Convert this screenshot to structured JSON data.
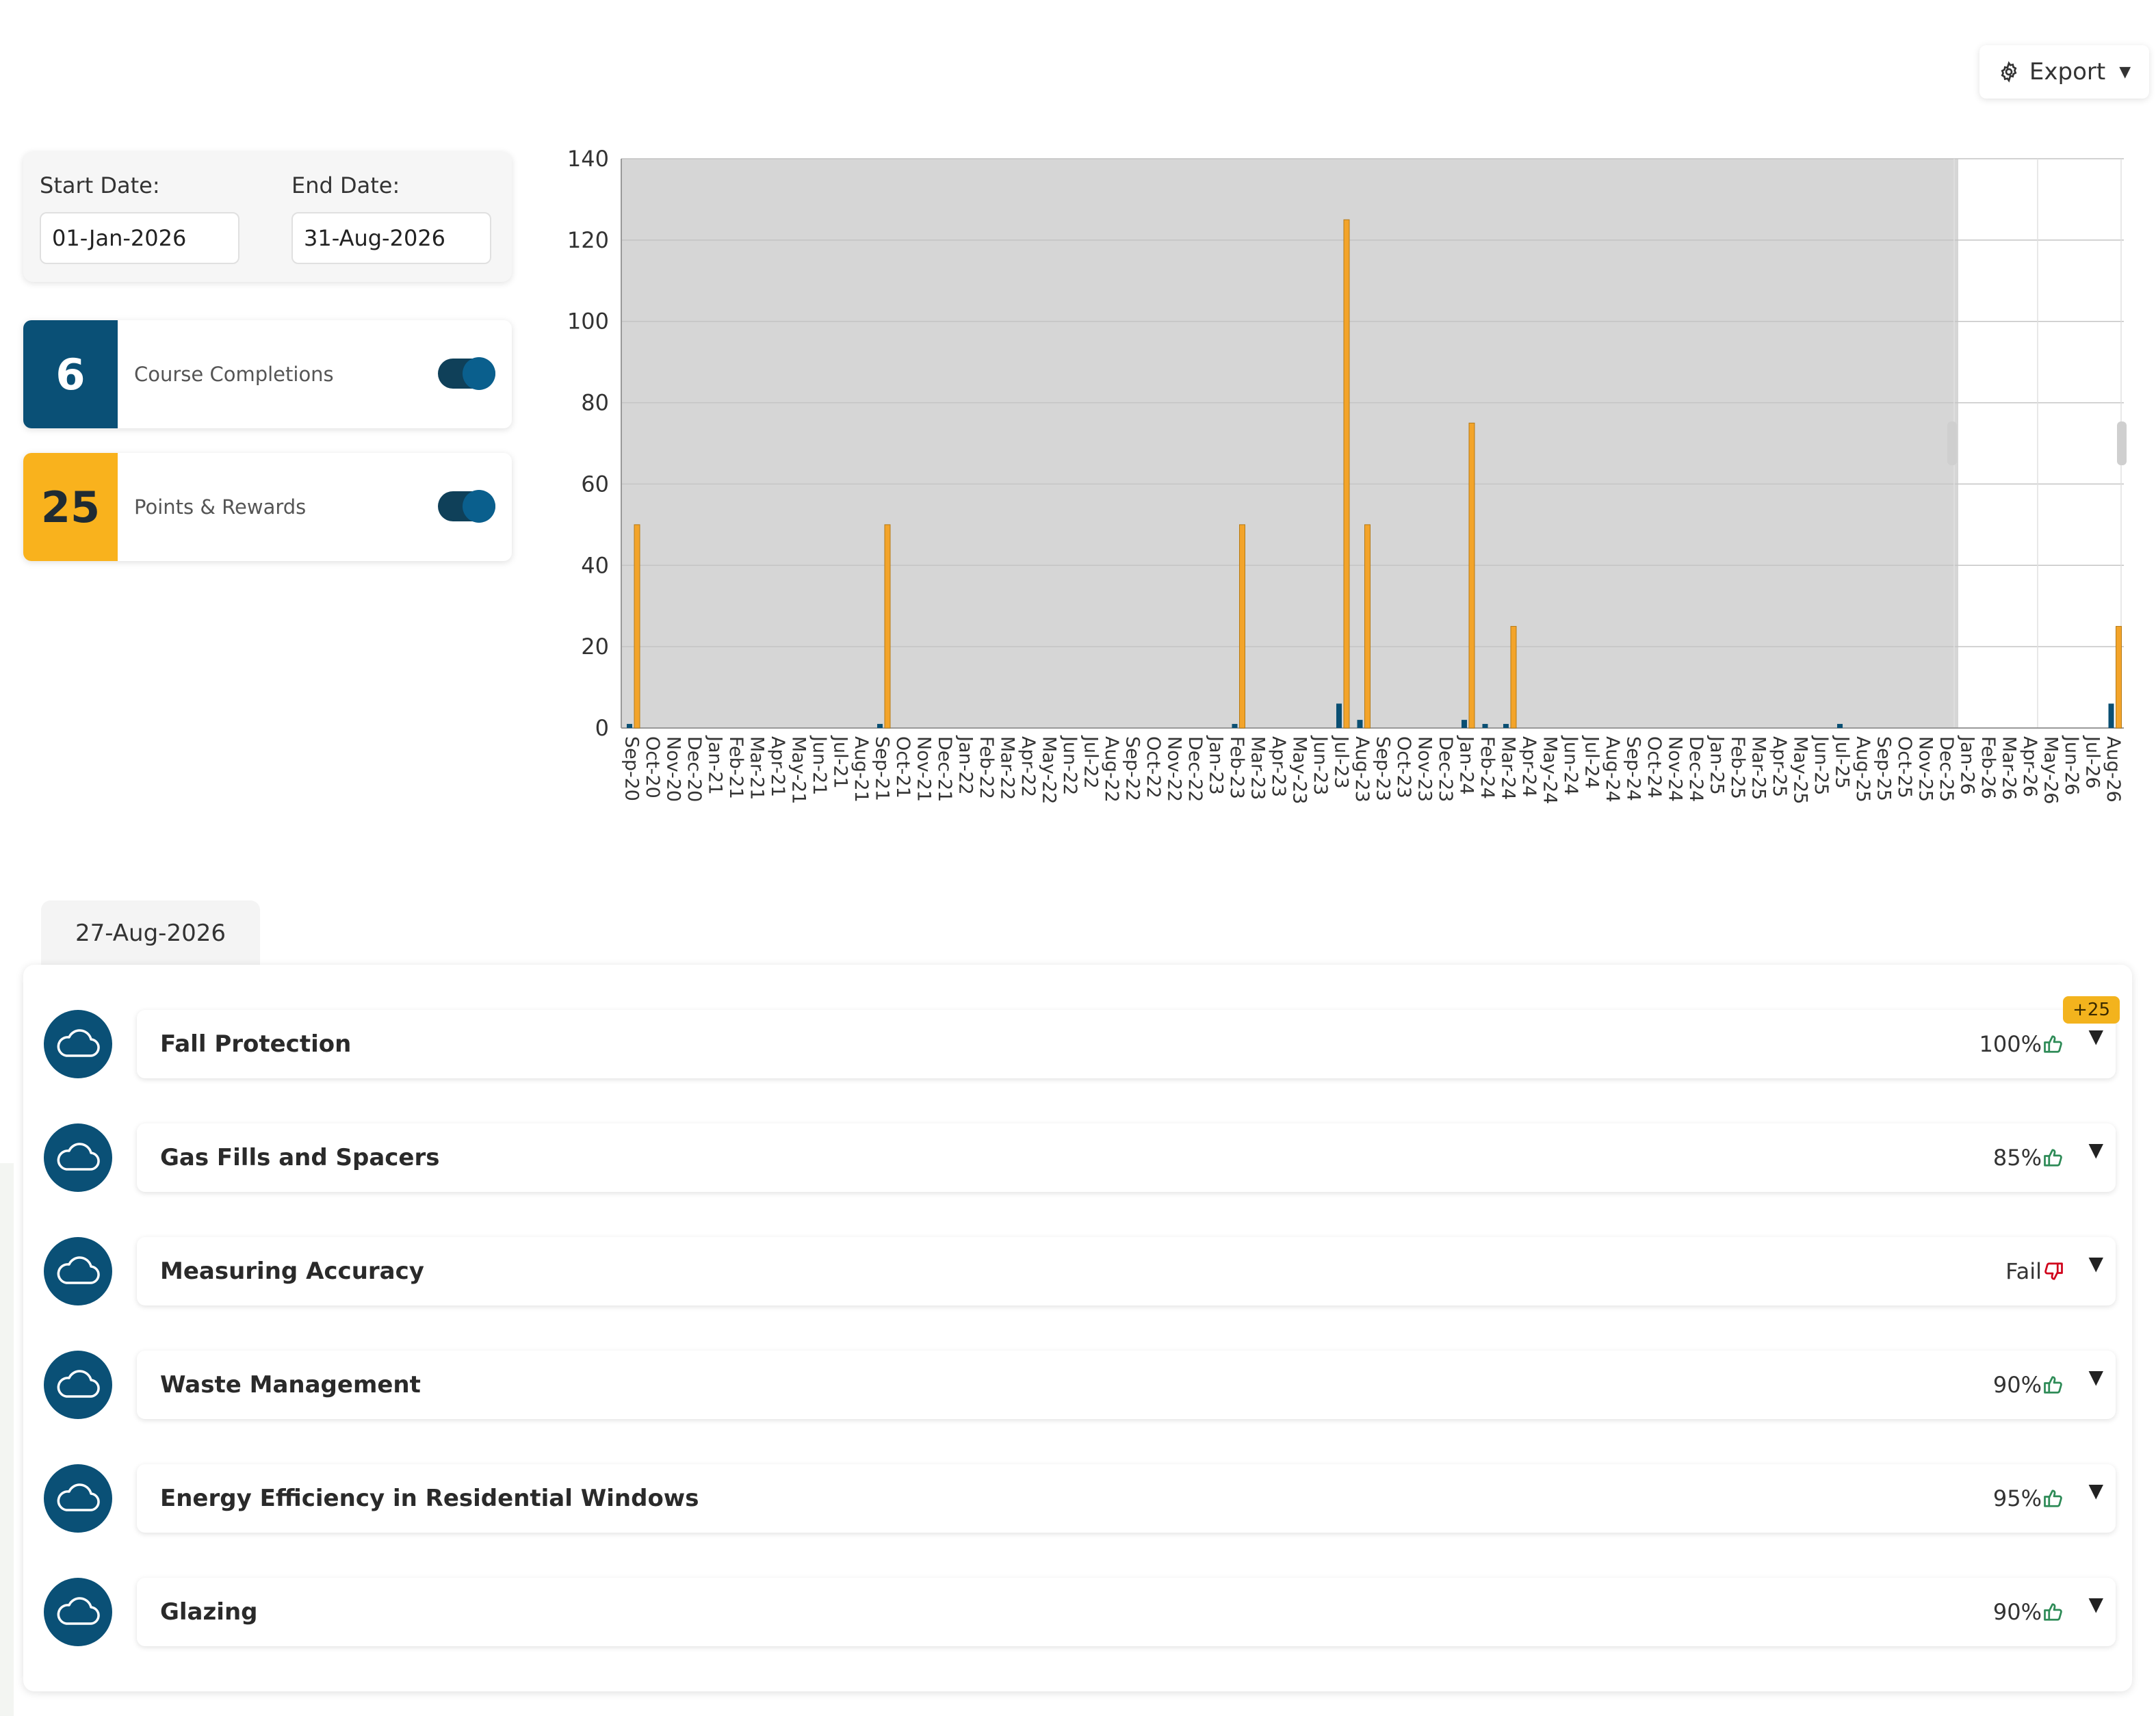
{
  "toolbar": {
    "export_label": "Export"
  },
  "filters": {
    "start_label": "Start Date:",
    "start_value": "01-Jan-2026",
    "end_label": "End Date:",
    "end_value": "31-Aug-2026"
  },
  "stats": [
    {
      "value": "6",
      "label": "Course Completions",
      "color": "#0a5076",
      "text_color": "#ffffff",
      "toggle_on": true
    },
    {
      "value": "25",
      "label": "Points & Rewards",
      "color": "#f9b21d",
      "text_color": "#1f2b33",
      "toggle_on": true
    }
  ],
  "chart_data": {
    "type": "bar",
    "categories": [
      "Sep-20",
      "Oct-20",
      "Nov-20",
      "Dec-20",
      "Jan-21",
      "Feb-21",
      "Mar-21",
      "Apr-21",
      "May-21",
      "Jun-21",
      "Jul-21",
      "Aug-21",
      "Sep-21",
      "Oct-21",
      "Nov-21",
      "Dec-21",
      "Jan-22",
      "Feb-22",
      "Mar-22",
      "Apr-22",
      "May-22",
      "Jun-22",
      "Jul-22",
      "Aug-22",
      "Sep-22",
      "Oct-22",
      "Nov-22",
      "Dec-22",
      "Jan-23",
      "Feb-23",
      "Mar-23",
      "Apr-23",
      "May-23",
      "Jun-23",
      "Jul-23",
      "Aug-23",
      "Sep-23",
      "Oct-23",
      "Nov-23",
      "Dec-23",
      "Jan-24",
      "Feb-24",
      "Mar-24",
      "Apr-24",
      "May-24",
      "Jun-24",
      "Jul-24",
      "Aug-24",
      "Sep-24",
      "Oct-24",
      "Nov-24",
      "Dec-24",
      "Jan-25",
      "Feb-25",
      "Mar-25",
      "Apr-25",
      "May-25",
      "Jun-25",
      "Jul-25",
      "Aug-25",
      "Sep-25",
      "Oct-25",
      "Nov-25",
      "Dec-25",
      "Jan-26",
      "Feb-26",
      "Mar-26",
      "Apr-26",
      "May-26",
      "Jun-26",
      "Jul-26",
      "Aug-26"
    ],
    "series": [
      {
        "values": [
          1,
          0,
          0,
          0,
          0,
          0,
          0,
          0,
          0,
          0,
          0,
          0,
          1,
          0,
          0,
          0,
          0,
          0,
          0,
          0,
          0,
          0,
          0,
          0,
          0,
          0,
          0,
          0,
          0,
          1,
          0,
          0,
          0,
          0,
          6,
          2,
          0,
          0,
          0,
          0,
          2,
          1,
          1,
          0,
          0,
          0,
          0,
          0,
          0,
          0,
          0,
          0,
          0,
          0,
          0,
          0,
          0,
          0,
          1,
          0,
          0,
          0,
          0,
          0,
          0,
          0,
          0,
          0,
          0,
          0,
          0,
          6
        ],
        "color": "#0a4f73"
      },
      {
        "values": [
          50,
          0,
          0,
          0,
          0,
          0,
          0,
          0,
          0,
          0,
          0,
          0,
          50,
          0,
          0,
          0,
          0,
          0,
          0,
          0,
          0,
          0,
          0,
          0,
          0,
          0,
          0,
          0,
          0,
          50,
          0,
          0,
          0,
          0,
          125,
          50,
          0,
          0,
          0,
          0,
          75,
          0,
          25,
          0,
          0,
          0,
          0,
          0,
          0,
          0,
          0,
          0,
          0,
          0,
          0,
          0,
          0,
          0,
          0,
          0,
          0,
          0,
          0,
          0,
          0,
          0,
          0,
          0,
          0,
          0,
          0,
          25
        ],
        "color": "#f3a42a"
      }
    ],
    "ylim": [
      0,
      140
    ],
    "yticks": [
      "0",
      "20",
      "40",
      "60",
      "80",
      "100",
      "120",
      "140"
    ],
    "shaded_range": [
      "Sep-20",
      "Dec-25"
    ],
    "grid": true,
    "xlabel": "",
    "ylabel": ""
  },
  "completions": {
    "date_tab": "27-Aug-2026",
    "items": [
      {
        "title": "Fall Protection",
        "score": "100%",
        "result": "pass",
        "points": "+25"
      },
      {
        "title": "Gas Fills and Spacers",
        "score": "85%",
        "result": "pass"
      },
      {
        "title": "Measuring Accuracy",
        "score": "Fail",
        "result": "fail"
      },
      {
        "title": "Waste Management",
        "score": "90%",
        "result": "pass"
      },
      {
        "title": "Energy Efficiency in Residential Windows",
        "score": "95%",
        "result": "pass"
      },
      {
        "title": "Glazing",
        "score": "90%",
        "result": "pass"
      }
    ]
  }
}
